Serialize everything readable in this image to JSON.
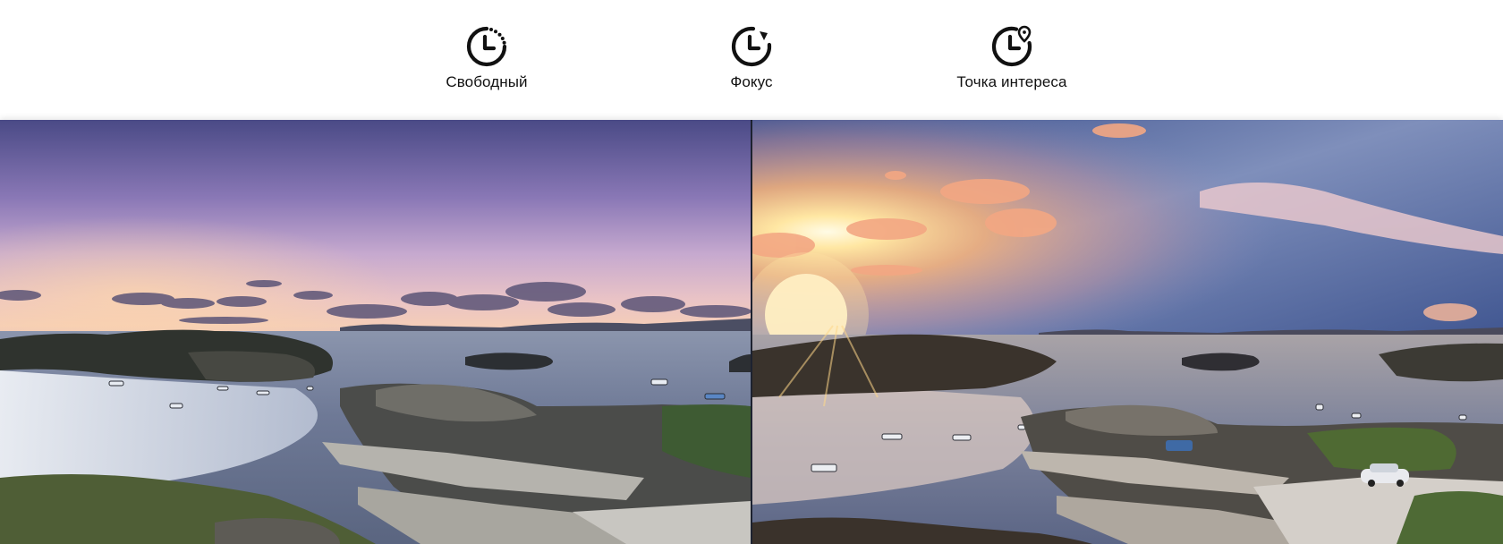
{
  "modes": [
    {
      "label": "Свободный",
      "icon": "timer-dotted-icon"
    },
    {
      "label": "Фокус",
      "icon": "timer-focus-icon"
    },
    {
      "label": "Точка интереса",
      "icon": "timer-location-pin-icon"
    }
  ],
  "photos": {
    "left": "dusk-coastal-harbor-photo",
    "right": "sunset-coastal-harbor-photo"
  }
}
